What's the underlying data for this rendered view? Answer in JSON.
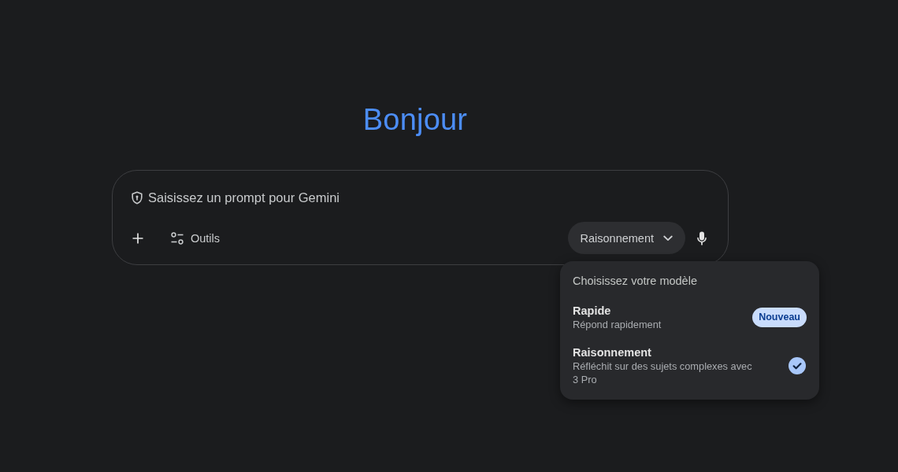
{
  "greeting": "Bonjour",
  "prompt": {
    "placeholder": "Saisissez un prompt pour Gemini"
  },
  "toolbar": {
    "tools_label": "Outils",
    "model_button": {
      "label": "Raisonnement",
      "expanded": true
    }
  },
  "model_menu": {
    "title": "Choisissez votre modèle",
    "options": [
      {
        "name": "Rapide",
        "description": "Répond rapidement",
        "badge": "Nouveau",
        "selected": false
      },
      {
        "name": "Raisonnement",
        "description": "Réfléchit sur des sujets complexes avec 3 Pro",
        "selected": true
      }
    ]
  }
}
